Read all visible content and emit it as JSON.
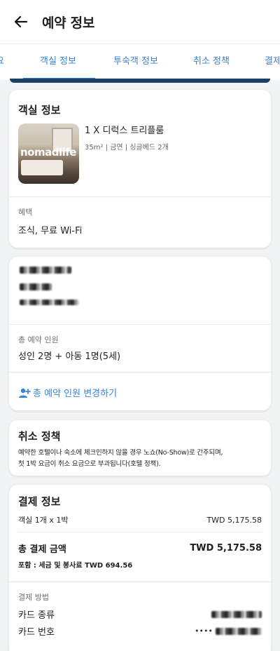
{
  "header": {
    "title": "예약 정보"
  },
  "tabs": [
    {
      "label": "요"
    },
    {
      "label": "객실 정보"
    },
    {
      "label": "투숙객 정보"
    },
    {
      "label": "취소 정책"
    },
    {
      "label": "결제"
    }
  ],
  "room": {
    "section_title": "객실 정보",
    "name": "1 X 디럭스 트리플룸",
    "specs": "35m² | 금연 | 싱글베드 2개",
    "image_watermark": "nomadlife",
    "benefit_label": "혜택",
    "benefit_value": "조식, 무료 Wi-Fi"
  },
  "guests": {
    "total_label": "총 예약 인원",
    "total_value": "성인 2명 + 아동 1명(5세)",
    "change_link": "총 예약 인원 변경하기"
  },
  "cancel": {
    "title": "취소 정책",
    "text_line1": "예약한 호텔이나 숙소에 체크인하지 않을 경우 노쇼(No-Show)로 간주되며,",
    "text_line2": "첫 1박 요금이 취소 요금으로 부과됩니다(호텔 정책)."
  },
  "payment": {
    "title": "결제 정보",
    "room_line_label": "객실 1개 x 1박",
    "room_line_value": "TWD 5,175.58",
    "total_label": "총 결제 금액",
    "total_value": "TWD 5,175.58",
    "tax_note": "포함 : 세금 및 봉사료 TWD 694.56",
    "method_label": "결제 방법",
    "card_type_label": "카드 종류",
    "card_number_label": "카드 번호",
    "card_number_prefix": "••••"
  },
  "colors": {
    "accent": "#3b82d6",
    "background": "#f2f3f5"
  }
}
